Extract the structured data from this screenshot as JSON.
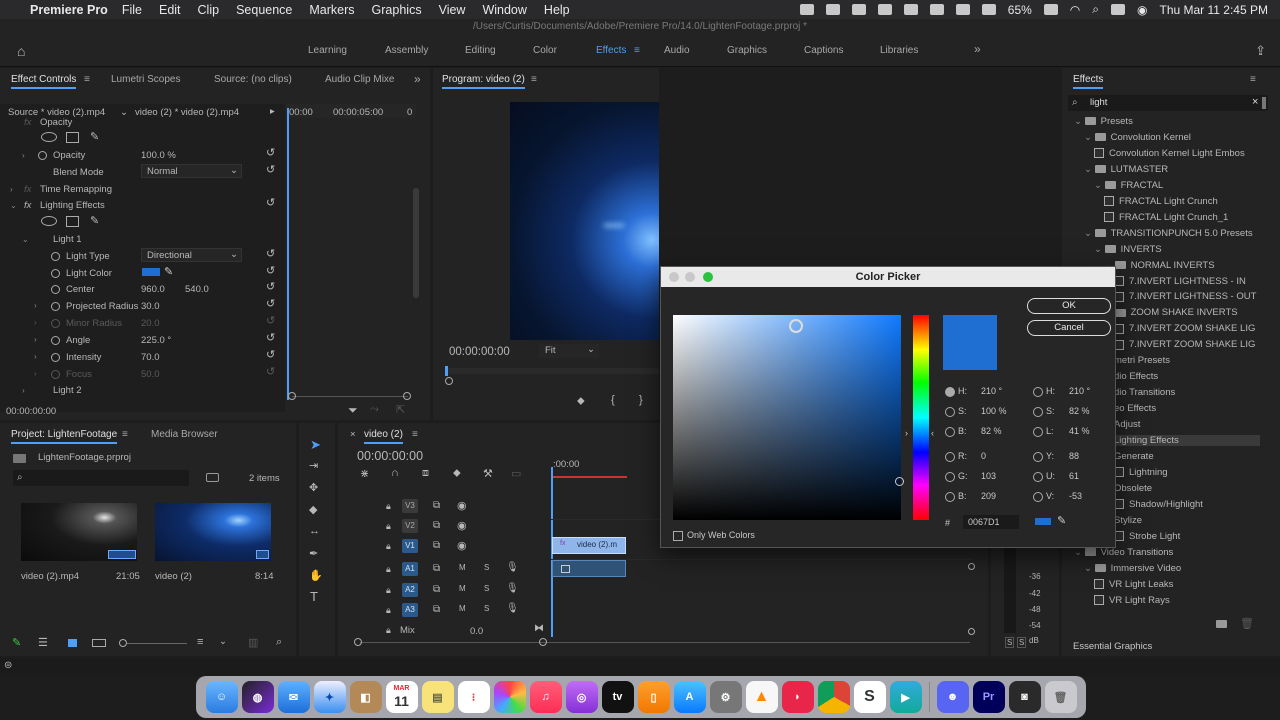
{
  "menubar": {
    "app": "Premiere Pro",
    "items": [
      "File",
      "Edit",
      "Clip",
      "Sequence",
      "Markers",
      "Graphics",
      "View",
      "Window",
      "Help"
    ],
    "battery": "65%",
    "datetime": "Thu Mar 11  2:45 PM"
  },
  "title_path": "/Users/Curtis/Documents/Adobe/Premiere Pro/14.0/LightenFootage.prproj *",
  "workspaces": {
    "tabs": [
      "Learning",
      "Assembly",
      "Editing",
      "Color",
      "Effects",
      "Audio",
      "Graphics",
      "Captions",
      "Libraries"
    ],
    "active": "Effects",
    "more": "»"
  },
  "effect_controls": {
    "tabs": [
      "Effect Controls",
      "Lumetri Scopes",
      "Source: (no clips)",
      "Audio Clip Mixe"
    ],
    "source_label": "Source * video (2).mp4",
    "sequence_label": "video (2) * video (2).mp4",
    "ruler": [
      "00:00",
      "00:00:05:00",
      "0"
    ],
    "opacity_section": "Opacity",
    "opacity_label": "Opacity",
    "opacity_value": "100.0 %",
    "blend_label": "Blend Mode",
    "blend_value": "Normal",
    "time_remap": "Time Remapping",
    "lighting": "Lighting Effects",
    "light1": "Light 1",
    "light_type_label": "Light Type",
    "light_type_value": "Directional",
    "light_color_label": "Light Color",
    "light_color": "#1e6fd1",
    "center_label": "Center",
    "center_x": "960.0",
    "center_y": "540.0",
    "proj_radius_label": "Projected Radius",
    "proj_radius_value": "30.0",
    "minor_radius_label": "Minor Radius",
    "minor_radius_value": "20.0",
    "angle_label": "Angle",
    "angle_value": "225.0 °",
    "intensity_label": "Intensity",
    "intensity_value": "70.0",
    "focus_label": "Focus",
    "focus_value": "50.0",
    "light2": "Light 2",
    "timecode": "00:00:00:00"
  },
  "program": {
    "title": "Program: video (2)",
    "timecode": "00:00:00:00",
    "zoom": "Fit"
  },
  "project": {
    "tabs": [
      "Project: LightenFootage",
      "Media Browser"
    ],
    "file": "LightenFootage.prproj",
    "items_count": "2 items",
    "clips": [
      {
        "name": "video (2).mp4",
        "duration": "21:05"
      },
      {
        "name": "video (2)",
        "duration": "8:14"
      }
    ]
  },
  "timeline": {
    "title": "video (2)",
    "timecode": "00:00:00:00",
    "ruler": ":00:00",
    "tracks": [
      {
        "name": "V3"
      },
      {
        "name": "V2"
      },
      {
        "name": "V1"
      },
      {
        "name": "A1"
      },
      {
        "name": "A2"
      },
      {
        "name": "A3"
      }
    ],
    "mute_label": "M",
    "solo_label": "S",
    "mix_label": "Mix",
    "mix_value": "0.0",
    "clip_label": "video (2).m"
  },
  "effects": {
    "title": "Effects",
    "search": "light",
    "tree": [
      {
        "label": "Presets",
        "type": "folder",
        "indent": 0
      },
      {
        "label": "Convolution Kernel",
        "type": "folder",
        "indent": 1
      },
      {
        "label": "Convolution Kernel Light Embos",
        "type": "fx",
        "indent": 2
      },
      {
        "label": "LUTMASTER",
        "type": "folder",
        "indent": 1
      },
      {
        "label": "FRACTAL",
        "type": "folder",
        "indent": 2
      },
      {
        "label": "FRACTAL Light Crunch",
        "type": "fx",
        "indent": 3
      },
      {
        "label": "FRACTAL Light Crunch_1",
        "type": "fx",
        "indent": 3
      },
      {
        "label": "TRANSITIONPUNCH 5.0 Presets",
        "type": "folder",
        "indent": 1
      },
      {
        "label": "INVERTS",
        "type": "folder",
        "indent": 2
      },
      {
        "label": "NORMAL INVERTS",
        "type": "folder",
        "indent": 3
      },
      {
        "label": "7.INVERT LIGHTNESS - IN",
        "type": "fx",
        "indent": 4
      },
      {
        "label": "7.INVERT LIGHTNESS - OUT",
        "type": "fx",
        "indent": 4
      },
      {
        "label": "ZOOM SHAKE INVERTS",
        "type": "folder",
        "indent": 3
      },
      {
        "label": "7.INVERT ZOOM SHAKE LIG",
        "type": "fx",
        "indent": 4
      },
      {
        "label": "7.INVERT ZOOM SHAKE LIG",
        "type": "fx",
        "indent": 4
      },
      {
        "label": "metri Presets",
        "type": "plain",
        "indent": 4
      },
      {
        "label": "dio Effects",
        "type": "plain",
        "indent": 4
      },
      {
        "label": "dio Transitions",
        "type": "plain",
        "indent": 4
      },
      {
        "label": "eo Effects",
        "type": "plain",
        "indent": 4
      },
      {
        "label": "Adjust",
        "type": "plain",
        "indent": 4
      },
      {
        "label": "Lighting Effects",
        "type": "selected",
        "indent": 4
      },
      {
        "label": "Generate",
        "type": "plain",
        "indent": 4
      },
      {
        "label": "Lightning",
        "type": "fx",
        "indent": 4
      },
      {
        "label": "Obsolete",
        "type": "plain",
        "indent": 4
      },
      {
        "label": "Shadow/Highlight",
        "type": "fx",
        "indent": 4
      },
      {
        "label": "Stylize",
        "type": "plain",
        "indent": 4
      },
      {
        "label": "Strobe Light",
        "type": "fx",
        "indent": 4
      },
      {
        "label": "Video Transitions",
        "type": "folder",
        "indent": 0
      },
      {
        "label": "Immersive Video",
        "type": "folder",
        "indent": 1
      },
      {
        "label": "VR Light Leaks",
        "type": "fx",
        "indent": 2
      },
      {
        "label": "VR Light Rays",
        "type": "fx",
        "indent": 2
      }
    ],
    "essential_graphics": "Essential Graphics"
  },
  "meter": {
    "ticks": [
      "-36",
      "-42",
      "-48",
      "-54",
      "dB"
    ],
    "buttons": [
      "S",
      "S"
    ]
  },
  "color_picker": {
    "title": "Color Picker",
    "ok": "OK",
    "cancel": "Cancel",
    "swatch": "#0067D1",
    "hsb": [
      {
        "k": "H:",
        "v": "210 °"
      },
      {
        "k": "S:",
        "v": "100 %"
      },
      {
        "k": "B:",
        "v": "82 %"
      }
    ],
    "rgb": [
      {
        "k": "R:",
        "v": "0"
      },
      {
        "k": "G:",
        "v": "103"
      },
      {
        "k": "B:",
        "v": "209"
      }
    ],
    "hsl": [
      {
        "k": "H:",
        "v": "210 °"
      },
      {
        "k": "S:",
        "v": "82 %"
      },
      {
        "k": "L:",
        "v": "41 %"
      }
    ],
    "yuv": [
      {
        "k": "Y:",
        "v": "88"
      },
      {
        "k": "U:",
        "v": "61"
      },
      {
        "k": "V:",
        "v": "-53"
      }
    ],
    "hash": "#",
    "hex": "0067D1",
    "web_only": "Only Web Colors"
  },
  "dock": {
    "calendar_month": "MAR",
    "calendar_day": "11",
    "items": [
      "finder-icon",
      "siri-icon",
      "mail-icon",
      "safari-icon",
      "notes-icon",
      "calendar-icon",
      "reminders-icon",
      "photos-icon",
      "music-icon",
      "podcasts-icon",
      "tv-icon",
      "books-icon",
      "appstore-icon",
      "preferences-icon",
      "vlc-icon",
      "cast-icon",
      "chrome-icon",
      "skype-icon",
      "maps-icon",
      "discord-icon",
      "premiere-icon",
      "game-icon",
      "trash-icon"
    ]
  }
}
